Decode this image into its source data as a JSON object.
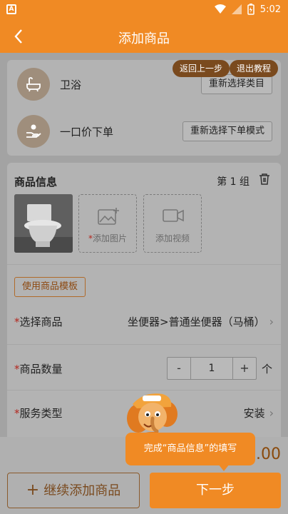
{
  "status_bar": {
    "time": "5:02",
    "app_icon": "A"
  },
  "header": {
    "title": "添加商品",
    "back_icon": "chevron-left-icon"
  },
  "guide": {
    "back_step": "返回上一步",
    "exit_tutorial": "退出教程"
  },
  "category": {
    "label": "卫浴",
    "button": "重新选择类目",
    "icon": "bathtub-icon"
  },
  "order_mode": {
    "label": "一口价下单",
    "button": "重新选择下单模式",
    "icon": "hand-user-icon"
  },
  "product_info": {
    "title": "商品信息",
    "group_label": "第 1 组",
    "add_image": "添加图片",
    "add_image_required": "*",
    "add_video": "添加视频",
    "template_button": "使用商品模板",
    "fields": {
      "product": {
        "label": "选择商品",
        "value": "坐便器>普通坐便器（马桶）"
      },
      "quantity": {
        "label": "商品数量",
        "value": "1",
        "unit": "个",
        "minus": "-",
        "plus": "+"
      },
      "service": {
        "label": "服务类型",
        "value": "安装"
      }
    },
    "required_mark": "*"
  },
  "footer": {
    "price_partial": "0.00",
    "add_more": "继续添加商品",
    "add_more_icon": "+",
    "next": "下一步"
  },
  "tooltip": {
    "text": "完成“商品信息”的填写"
  },
  "colors": {
    "brand": "#f08a24",
    "overlay": "#a3a3a3",
    "required": "#b3261e"
  }
}
